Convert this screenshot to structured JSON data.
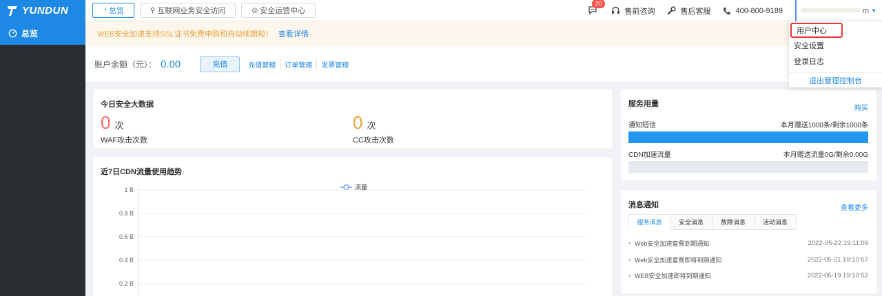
{
  "brand": {
    "name": "YUNDUN",
    "color": "#1e88e5"
  },
  "top_tabs": [
    {
      "icon": "dashboard-icon",
      "label": "总览",
      "active": true
    },
    {
      "icon": "link-icon",
      "label": "互联网业务安全访问",
      "active": false
    },
    {
      "icon": "shield-icon",
      "label": "安全运营中心",
      "active": false
    }
  ],
  "header_right": {
    "message_count": "20",
    "presale": "售前咨询",
    "aftersale": "售后客服",
    "phone": "400-800-9189",
    "user_suffix": "m"
  },
  "sidebar": {
    "items": [
      {
        "icon": "dashboard-icon",
        "label": "总览"
      }
    ]
  },
  "notice": {
    "text": "WEB安全加速支持SSL证书免费申购和自动续期啦！",
    "link": "查看详情"
  },
  "account": {
    "label": "账户余额（元）：",
    "amount": "0.00",
    "recharge_button": "充值",
    "links": [
      "充值管理",
      "订单管理",
      "发票管理"
    ]
  },
  "security": {
    "title": "今日安全大数据",
    "waf": {
      "value": "0",
      "unit": "次",
      "label": "WAF攻击次数",
      "color": "#f56c6c"
    },
    "cc": {
      "value": "0",
      "unit": "次",
      "label": "CC攻击次数",
      "color": "#e6a23c"
    }
  },
  "trend": {
    "title": "近7日CDN流量使用趋势"
  },
  "chart_data": {
    "type": "line",
    "series": [
      {
        "name": "流量",
        "values": []
      }
    ],
    "y_ticks": [
      "1 B",
      "0.8 B",
      "0.6 B",
      "0.4 B",
      "0.2 B"
    ],
    "ylim": [
      0,
      1
    ],
    "grid": true,
    "legend": "top-center"
  },
  "usage": {
    "title": "服务用量",
    "buy": "购买",
    "sms": {
      "label": "通知短信",
      "detail": "本月赠送1000条/剩余1000条",
      "percent": 100,
      "color": "#2196f3"
    },
    "cdn": {
      "label": "CDN加速流量",
      "detail": "本月赠送流量0G/剩余0.00G",
      "percent": 0,
      "color": "#e6eaf0"
    }
  },
  "news": {
    "title": "消息通知",
    "more": "查看更多",
    "tabs": [
      "服务消息",
      "安全消息",
      "故障消息",
      "活动消息"
    ],
    "items": [
      {
        "text": "Web安全加速套餐到期通知",
        "date": "2022-05-22 19:11:09"
      },
      {
        "text": "Web安全加速套餐即将到期通知",
        "date": "2022-05-21 19:10:57"
      },
      {
        "text": "WEB安全加速即将到期通知",
        "date": "2022-05-19 19:10:52"
      }
    ]
  },
  "user_menu": {
    "items": [
      "用户中心",
      "安全设置",
      "登录日志"
    ],
    "logout": "退出管理控制台"
  }
}
